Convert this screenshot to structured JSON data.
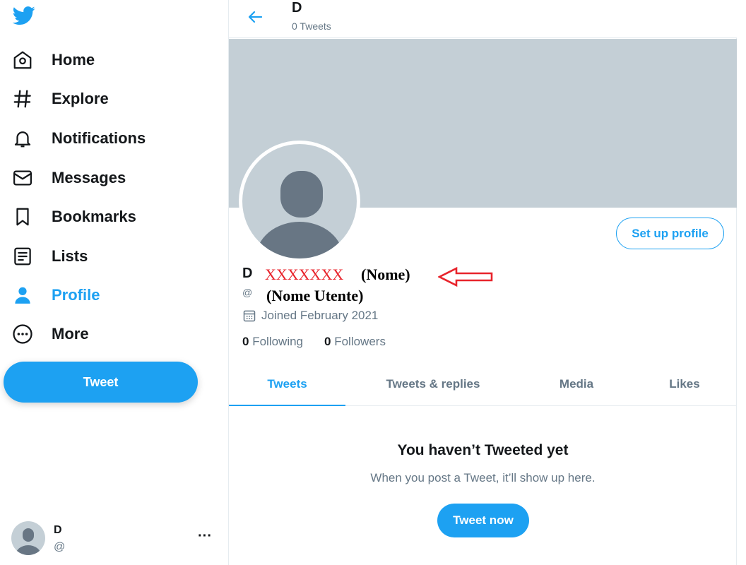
{
  "sidebar": {
    "items": [
      {
        "label": "Home",
        "icon": "home-icon"
      },
      {
        "label": "Explore",
        "icon": "hashtag-icon"
      },
      {
        "label": "Notifications",
        "icon": "bell-icon"
      },
      {
        "label": "Messages",
        "icon": "envelope-icon"
      },
      {
        "label": "Bookmarks",
        "icon": "bookmark-icon"
      },
      {
        "label": "Lists",
        "icon": "list-icon"
      },
      {
        "label": "Profile",
        "icon": "person-icon",
        "active": true
      },
      {
        "label": "More",
        "icon": "more-circle-icon"
      }
    ],
    "tweet_label": "Tweet",
    "account": {
      "name": "D",
      "handle": "@"
    }
  },
  "header": {
    "title": "D",
    "subtitle": "0 Tweets"
  },
  "profile": {
    "name": "D",
    "redacted": "XXXXXXX",
    "name_note": "(Nome)",
    "handle": "@",
    "handle_note": "(Nome Utente)",
    "joined": "Joined February 2021",
    "following_count": "0",
    "following_label": "Following",
    "followers_count": "0",
    "followers_label": "Followers",
    "setup_label": "Set up profile"
  },
  "tabs": [
    {
      "label": "Tweets",
      "active": true
    },
    {
      "label": "Tweets & replies"
    },
    {
      "label": "Media"
    },
    {
      "label": "Likes"
    }
  ],
  "empty_state": {
    "title": "You haven’t Tweeted yet",
    "subtitle": "When you post a Tweet, it’ll show up here.",
    "button": "Tweet now"
  },
  "colors": {
    "accent": "#1da1f2",
    "annotation_red": "#e8242c",
    "placeholder_gray": "#c4cfd6",
    "avatar_figure": "#687684"
  }
}
